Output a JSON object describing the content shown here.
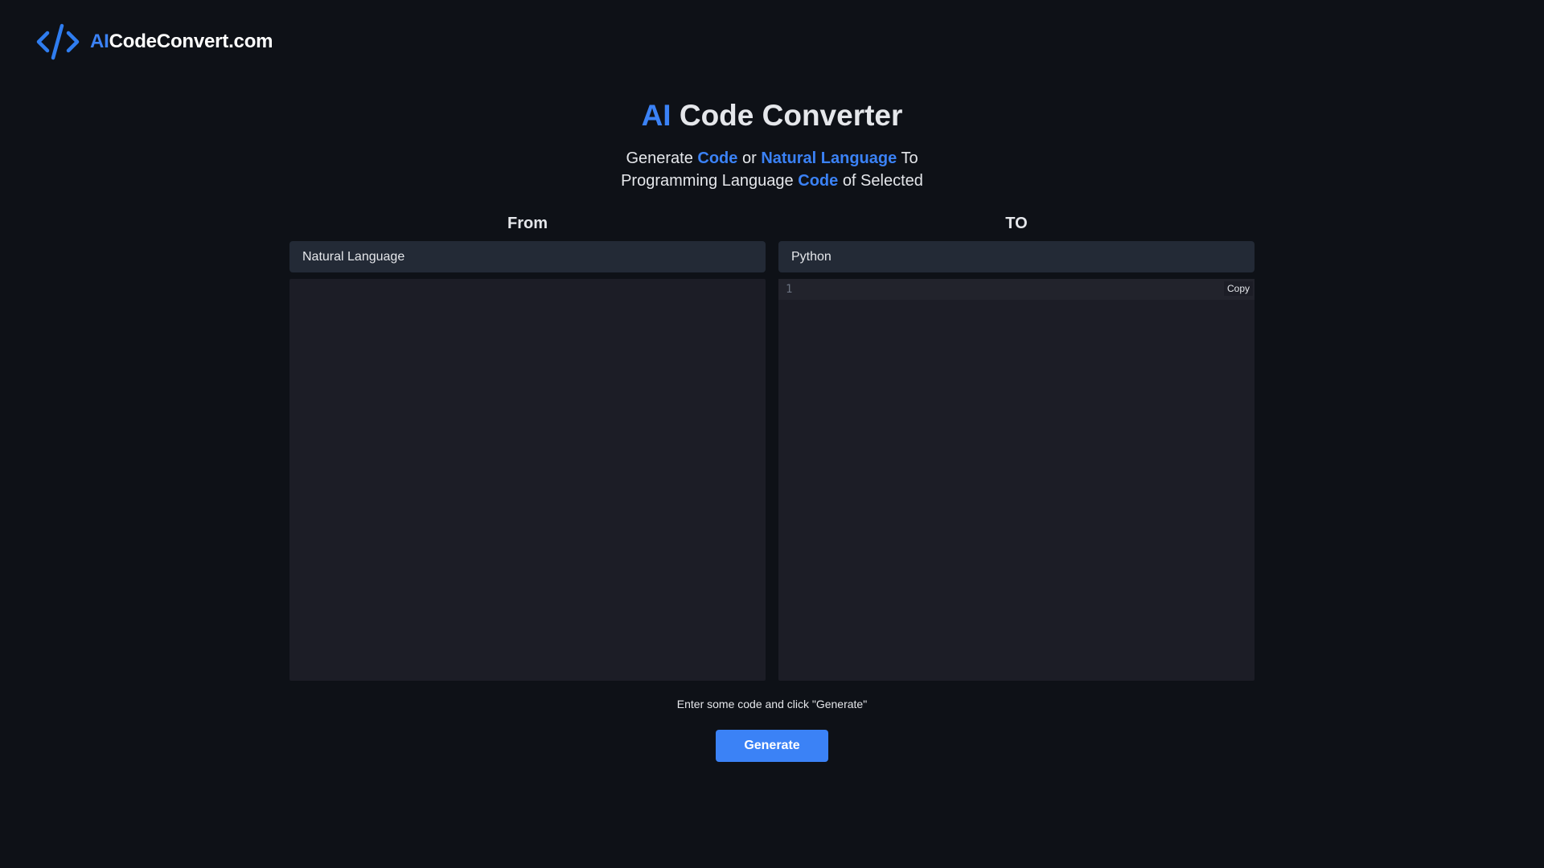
{
  "brand": {
    "prefix": "AI",
    "rest": "CodeConvert.com"
  },
  "hero": {
    "title_accent": "AI",
    "title_rest": "Code Converter",
    "sub": {
      "w1": "Generate",
      "hl1": "Code",
      "w2": "or",
      "hl2": "Natural Language",
      "w3": "To",
      "w4": "Programming Language",
      "hl3": "Code",
      "w5": "of Selected"
    }
  },
  "from": {
    "label": "From",
    "selected": "Natural Language",
    "input_value": ""
  },
  "to": {
    "label": "TO",
    "selected": "Python",
    "line_number": "1",
    "copy_label": "Copy"
  },
  "hint": "Enter some code and click \"Generate\"",
  "generate_label": "Generate",
  "colors": {
    "background": "#0e1117",
    "accent": "#3b82f6",
    "select_bg": "#232a36",
    "editor_bg": "#1c1d26"
  },
  "icons": {
    "logo": "code-brackets-icon"
  }
}
